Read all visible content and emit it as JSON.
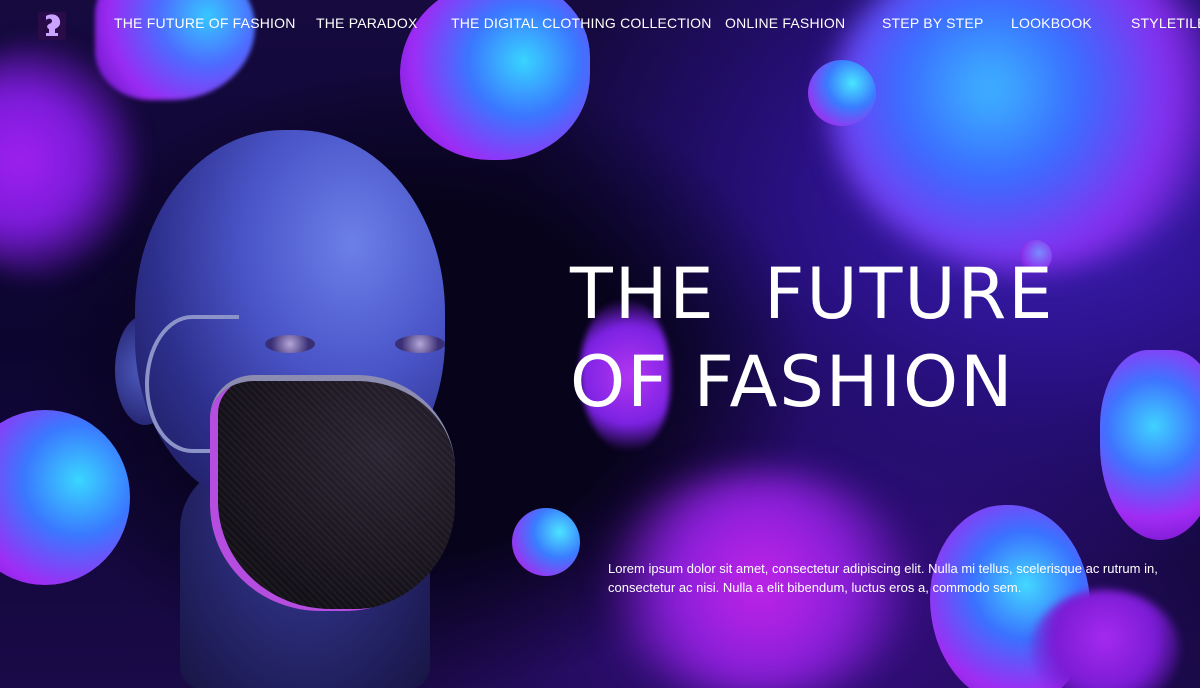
{
  "nav": {
    "logo_icon": "mannequin-head-logo-icon",
    "items": [
      {
        "label": "THE FUTURE OF FASHION"
      },
      {
        "label": "THE PARADOX"
      },
      {
        "label": "THE DIGITAL CLOTHING COLLECTION"
      },
      {
        "label": "ONLINE FASHION"
      },
      {
        "label": "STEP BY STEP"
      },
      {
        "label": "LOOKBOOK"
      },
      {
        "label": "STYLETILE"
      }
    ]
  },
  "hero": {
    "title_line1": "THE  FUTURE",
    "title_line2": "OF FASHION",
    "text": "Lorem ipsum dolor sit amet, consectetur adipiscing elit. Nulla mi tellus, scelerisque ac rutrum in, consectetur ac nisi. Nulla a elit bibendum, luctus eros a, commodo sem."
  },
  "colors": {
    "background": "#0c0530",
    "blob_blue": "#38d4ff",
    "blob_purple": "#9d2cf5",
    "text": "#ffffff"
  }
}
